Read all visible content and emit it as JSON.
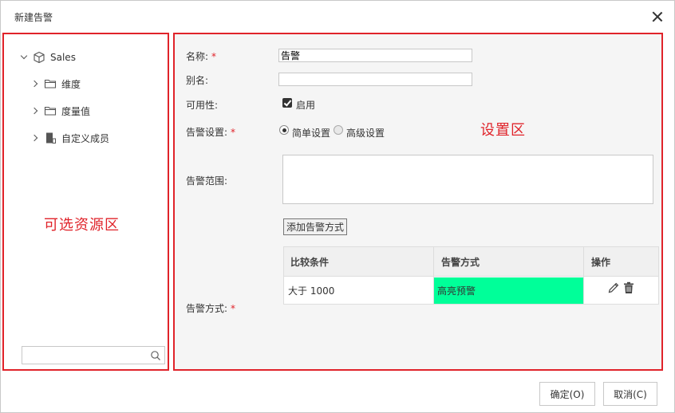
{
  "dialog": {
    "title": "新建告警",
    "close_icon": "close-icon"
  },
  "resource_panel": {
    "annotation": "可选资源区",
    "tree": {
      "root": {
        "label": "Sales",
        "icon": "cube-icon",
        "expanded": true
      },
      "children": [
        {
          "label": "维度",
          "icon": "folder-icon",
          "expanded": false
        },
        {
          "label": "度量值",
          "icon": "folder-icon",
          "expanded": false
        },
        {
          "label": "自定义成员",
          "icon": "custom-member-icon",
          "expanded": false
        }
      ]
    },
    "search": {
      "value": "",
      "placeholder": "",
      "icon": "search-icon"
    }
  },
  "settings_panel": {
    "annotation": "设置区",
    "name": {
      "label": "名称:",
      "required_mark": "*",
      "value": "告警"
    },
    "alias": {
      "label": "别名:",
      "value": ""
    },
    "availability": {
      "label": "可用性:",
      "checkbox_label": "启用",
      "checked": true
    },
    "alert_setting": {
      "label": "告警设置:",
      "required_mark": "*",
      "options": [
        {
          "label": "简单设置",
          "selected": true
        },
        {
          "label": "高级设置",
          "selected": false
        }
      ]
    },
    "alert_scope": {
      "label": "告警范围:",
      "value": ""
    },
    "alert_method": {
      "label": "告警方式:",
      "required_mark": "*",
      "add_button_label": "添加告警方式",
      "table": {
        "headers": [
          "比较条件",
          "告警方式",
          "操作"
        ],
        "rows": [
          {
            "condition": "大于 1000",
            "method": "高亮预警",
            "method_color": "#00ff99"
          }
        ]
      }
    }
  },
  "footer": {
    "ok_label": "确定(O)",
    "cancel_label": "取消(C)"
  },
  "colors": {
    "annotation_red": "#e0232a",
    "highlight_green": "#00ff99"
  }
}
